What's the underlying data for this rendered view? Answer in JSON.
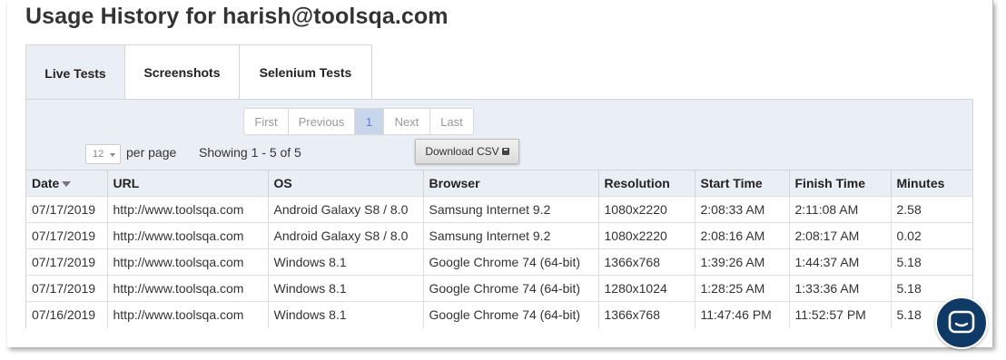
{
  "page": {
    "title": "Usage History for harish@toolsqa.com"
  },
  "tabs": [
    {
      "label": "Live Tests",
      "active": true
    },
    {
      "label": "Screenshots",
      "active": false
    },
    {
      "label": "Selenium Tests",
      "active": false
    }
  ],
  "pagination": {
    "first": "First",
    "previous": "Previous",
    "current": "1",
    "next": "Next",
    "last": "Last"
  },
  "controls": {
    "per_page_value": "12",
    "per_page_label": "per page",
    "showing": "Showing 1 - 5 of 5",
    "download_label": "Download CSV"
  },
  "table": {
    "headers": [
      "Date",
      "URL",
      "OS",
      "Browser",
      "Resolution",
      "Start Time",
      "Finish Time",
      "Minutes"
    ],
    "sort_column": "Date",
    "rows": [
      [
        "07/17/2019",
        "http://www.toolsqa.com",
        "Android Galaxy S8 / 8.0",
        "Samsung Internet 9.2",
        "1080x2220",
        "2:08:33 AM",
        "2:11:08 AM",
        "2.58"
      ],
      [
        "07/17/2019",
        "http://www.toolsqa.com",
        "Android Galaxy S8 / 8.0",
        "Samsung Internet 9.2",
        "1080x2220",
        "2:08:16 AM",
        "2:08:17 AM",
        "0.02"
      ],
      [
        "07/17/2019",
        "http://www.toolsqa.com",
        "Windows 8.1",
        "Google Chrome 74 (64-bit)",
        "1366x768",
        "1:39:26 AM",
        "1:44:37 AM",
        "5.18"
      ],
      [
        "07/17/2019",
        "http://www.toolsqa.com",
        "Windows 8.1",
        "Google Chrome 74 (64-bit)",
        "1280x1024",
        "1:28:25 AM",
        "1:33:36 AM",
        "5.18"
      ],
      [
        "07/16/2019",
        "http://www.toolsqa.com",
        "Windows 8.1",
        "Google Chrome 74 (64-bit)",
        "1366x768",
        "11:47:46 PM",
        "11:52:57 PM",
        "5.18"
      ]
    ]
  },
  "chat": {
    "icon": "chat-icon",
    "color": "#0f3a66"
  },
  "colors": {
    "panel_bg": "#eaeef5",
    "active_page_bg": "#c9d5eb"
  }
}
